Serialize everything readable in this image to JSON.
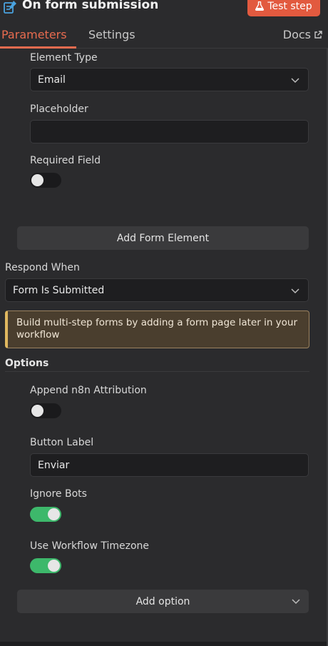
{
  "header": {
    "title": "On form submission",
    "test_step_label": "Test step",
    "icon": "form-edit-icon"
  },
  "tabs": [
    {
      "label": "Parameters",
      "active": true
    },
    {
      "label": "Settings",
      "active": false
    }
  ],
  "docs_label": "Docs",
  "form_element": {
    "element_type_label": "Element Type",
    "element_type_value": "Email",
    "placeholder_label": "Placeholder",
    "placeholder_value": "",
    "required_label": "Required Field",
    "required_on": false
  },
  "add_form_element_label": "Add Form Element",
  "respond_when": {
    "label": "Respond When",
    "value": "Form Is Submitted"
  },
  "notice_text": "Build multi-step forms by adding a form page later in your workflow",
  "options": {
    "title": "Options",
    "append_attribution_label": "Append n8n Attribution",
    "append_attribution_on": false,
    "button_label_label": "Button Label",
    "button_label_value": "Enviar",
    "ignore_bots_label": "Ignore Bots",
    "ignore_bots_on": true,
    "use_timezone_label": "Use Workflow Timezone",
    "use_timezone_on": true
  },
  "add_option_label": "Add option",
  "colors": {
    "accent": "#e86b4f",
    "toggle_on": "#3db86b",
    "notice_border": "#e0b860"
  }
}
